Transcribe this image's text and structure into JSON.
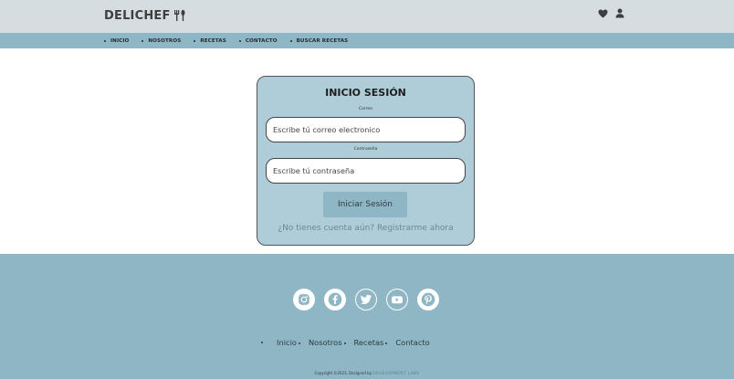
{
  "header": {
    "logo_text": "DELICHEF",
    "icons": [
      "heart-icon",
      "user-icon"
    ]
  },
  "nav": {
    "items": [
      "INICIO",
      "NOSOTROS",
      "RECETAS",
      "CONTACTO",
      "BUSCAR RECETAS"
    ]
  },
  "login": {
    "title": "INICIO SESIÓN",
    "email_label": "Correo",
    "email_placeholder": "Escribe tú correo electronico",
    "password_label": "Contraseña",
    "password_placeholder": "Escribe tú contraseña",
    "submit_label": "Iniciar Sesión",
    "register_text": "¿No tienes cuenta aún? Registrarme ahora"
  },
  "footer": {
    "social": [
      "instagram-icon",
      "facebook-icon",
      "twitter-icon",
      "youtube-icon",
      "pinterest-icon"
    ],
    "links": [
      "Inicio",
      "Nosotros",
      "Recetas",
      "Contacto"
    ],
    "copyright_prefix": "Copyright ©2023, Designed by",
    "developer": "DEVELOPMENT LABS"
  },
  "colors": {
    "topbar": "#d6dde0",
    "accent": "#8fb6c5",
    "card": "#afcdd8"
  }
}
